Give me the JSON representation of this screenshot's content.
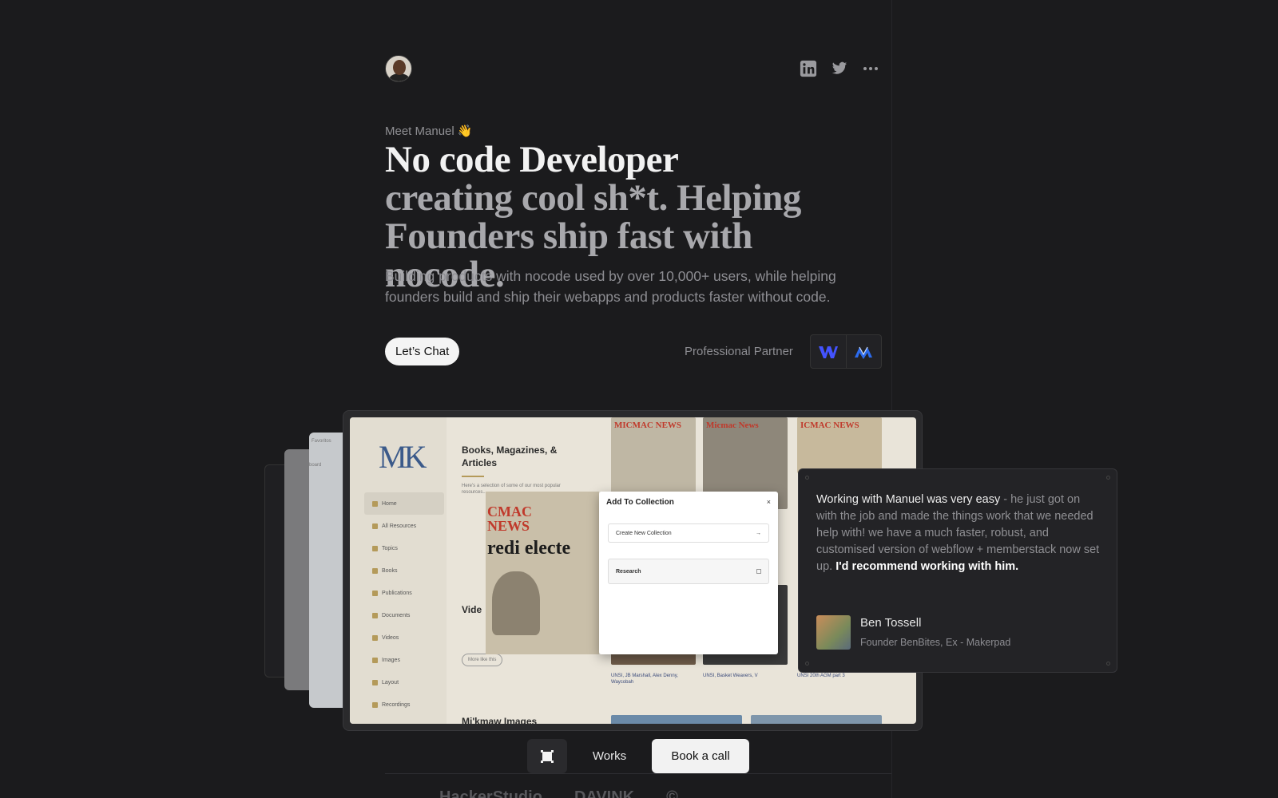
{
  "intro": {
    "eyebrow": "Meet Manuel 👋",
    "headline_line1": "No code Developer",
    "headline_line2": "creating cool sh*t. Helping Founders ship fast with nocode.",
    "lead": "Building products with nocode used by over 10,000+ users, while helping founders build and ship their webapps and products faster without code.",
    "cta_label": "Let’s Chat",
    "partner_label": "Professional Partner"
  },
  "social": {
    "icons": [
      "linkedin-icon",
      "twitter-icon",
      "more-icon"
    ]
  },
  "preview": {
    "sidebar_items": [
      "Home",
      "All Resources",
      "Topics",
      "Books",
      "Publications",
      "Documents",
      "Videos",
      "Images",
      "Layout",
      "Recordings"
    ],
    "section_title": "Books, Magazines, & Articles",
    "section_desc": "Here's a selection of some of our most popular resources...",
    "videos_title": "Vide",
    "bottom_title": "Mi'kmaw Images",
    "more_btn": "More like this",
    "thumb_news": [
      "MICMAC NEWS",
      "Micmac News",
      "ICMAC NEWS"
    ],
    "thumb_captions": [
      "UNSI, JB Marshall, Alex Denny, Waycobah",
      "UNSI, Basket Weavers, V",
      "UNSI 20th AGM part 3"
    ],
    "ghost_labels": [
      "Favoritos",
      "board"
    ],
    "modal": {
      "title": "Add To Collection",
      "close": "×",
      "create": "Create New Collection",
      "research": "Research",
      "img_news": "CMAC NEWS",
      "img_headline": "redi electe"
    }
  },
  "testimonial": {
    "quote_highlight": "Working with Manuel was very easy",
    "quote_body": " - he just got on with the job and made the things work that we needed help with! we have a much faster, robust, and customised version of webflow + memberstack now set up. ",
    "quote_bold": "I'd recommend working with him.",
    "name": "Ben Tossell",
    "role": "Founder BenBites, Ex - Makerpad"
  },
  "dock": {
    "works_label": "Works",
    "book_label": "Book a call"
  },
  "colors": {
    "background": "#1b1b1d",
    "webflow_blue": "#4353ff",
    "memberstack_blue": "#2c6bed"
  },
  "footer_logos": [
    "HackerStudio",
    "DAVINK",
    "©"
  ]
}
